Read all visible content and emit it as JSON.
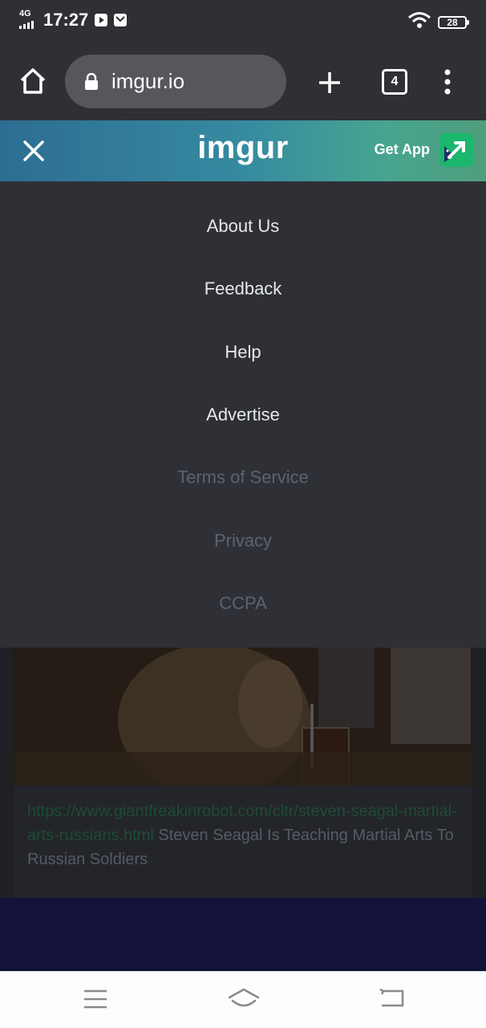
{
  "status_bar": {
    "network": "4G",
    "time": "17:27",
    "battery": "28"
  },
  "browser": {
    "url": "imgur.io",
    "tab_count": "4"
  },
  "site_header": {
    "logo": "imgur",
    "get_app_label": "Get App"
  },
  "menu": {
    "items": [
      {
        "label": "About Us"
      },
      {
        "label": "Feedback"
      },
      {
        "label": "Help"
      },
      {
        "label": "Advertise"
      },
      {
        "label": "Terms of Service"
      },
      {
        "label": "Privacy"
      },
      {
        "label": "CCPA"
      }
    ]
  },
  "post": {
    "link": "https://www.giantfreakinrobot.com/cltr/steven-seagal-martial-arts-russians.html",
    "title": "Steven Seagal Is Teaching Martial Arts To Russian Soldiers"
  },
  "colors": {
    "menu_bg": "#2e3036",
    "menu_text": "#e7e8ec",
    "menu_text_dim": "#5e6270",
    "header_gradient_start": "#2d6d93",
    "header_gradient_end": "#4f9e7c"
  }
}
